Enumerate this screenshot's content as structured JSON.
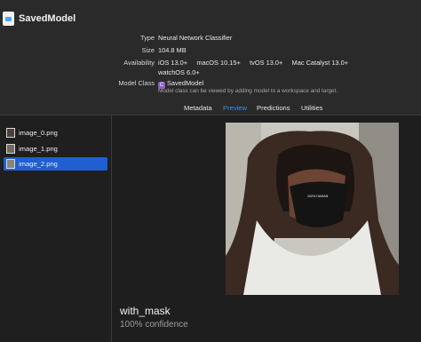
{
  "window": {
    "title": "SavedModel"
  },
  "details": {
    "type_key": "Type",
    "type_val": "Neural Network Classifier",
    "size_key": "Size",
    "size_val": "104.8 MB",
    "availability_key": "Availability",
    "availability_line1": "iOS 13.0+     macOS 10.15+     tvOS 13.0+     Mac Catalyst 13.0+",
    "availability_line2": "watchOS 6.0+",
    "model_class_key": "Model Class",
    "model_class_badge": "C",
    "model_class_val": "SavedModel",
    "model_class_note": "Model class can be viewed by adding model to a workspace and target."
  },
  "tabs": [
    {
      "label": "Metadata"
    },
    {
      "label": "Preview"
    },
    {
      "label": "Predictions"
    },
    {
      "label": "Utilities"
    }
  ],
  "active_tab": "Preview",
  "files": [
    {
      "label": "image_0.png"
    },
    {
      "label": "image_1.png"
    },
    {
      "label": "image_2.png"
    }
  ],
  "selected_file": "image_2.png",
  "prediction": {
    "label": "with_mask",
    "confidence": "100% confidence"
  },
  "colors": {
    "accent": "#1f5fd1",
    "active_tab": "#3a8ff0",
    "class_badge": "#8e5cc8",
    "mask_print": "100% HUMAN"
  }
}
